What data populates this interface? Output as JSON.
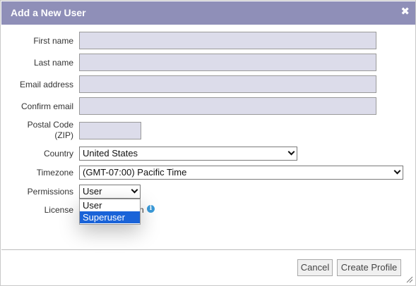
{
  "dialog": {
    "title": "Add a New User",
    "close_glyph": "✖"
  },
  "form": {
    "first_name": {
      "label": "First name",
      "value": ""
    },
    "last_name": {
      "label": "Last name",
      "value": ""
    },
    "email": {
      "label": "Email address",
      "value": ""
    },
    "confirm_email": {
      "label": "Confirm email",
      "value": ""
    },
    "postal": {
      "label_line1": "Postal Code",
      "label_line2": "(ZIP)",
      "value": ""
    },
    "country": {
      "label": "Country",
      "value": "United States"
    },
    "timezone": {
      "label": "Timezone",
      "value": "(GMT-07:00) Pacific Time"
    },
    "permissions": {
      "label": "Permissions",
      "value": "User",
      "options": [
        "User",
        "Superuser"
      ],
      "highlighted": "Superuser"
    },
    "license": {
      "label": "License",
      "partial_text": "n"
    }
  },
  "buttons": {
    "cancel": "Cancel",
    "create": "Create Profile"
  },
  "colors": {
    "titlebar": "#8f8fb8",
    "field_bg": "#dcdcea",
    "highlight": "#1a63d8",
    "info": "#3a9ad9"
  },
  "icons": [
    "close-icon",
    "chevron-down-icon",
    "info-icon",
    "resize-grip-icon"
  ]
}
